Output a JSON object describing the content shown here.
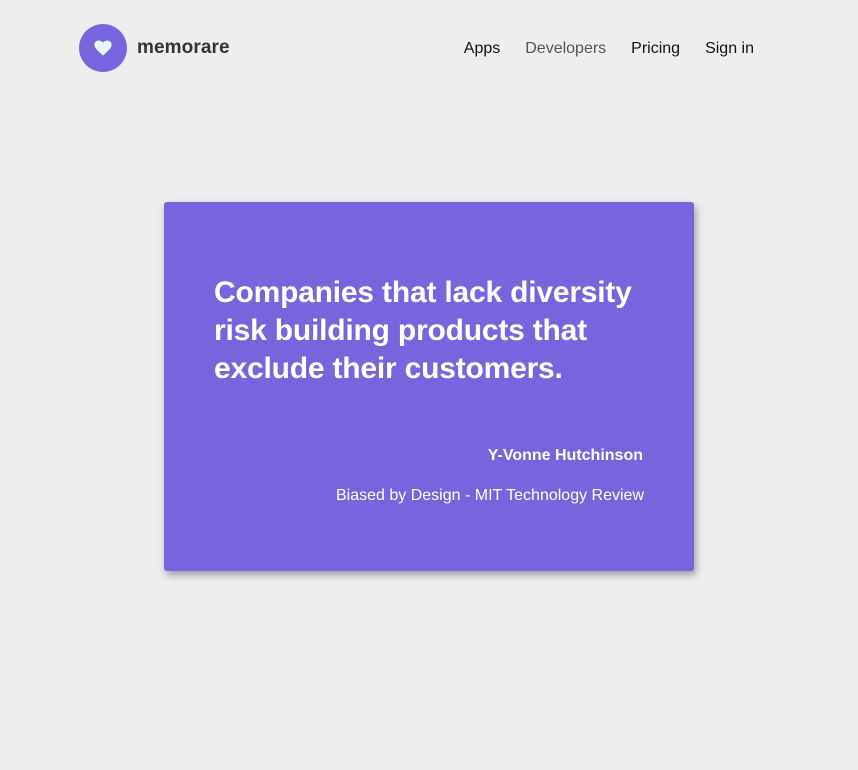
{
  "header": {
    "brand_name": "memorare",
    "logo_icon": "heart-icon",
    "nav": {
      "apps": "Apps",
      "developers": "Developers",
      "pricing": "Pricing",
      "sign_in": "Sign in"
    }
  },
  "quote_card": {
    "quote": "Companies that lack diversity risk building products that exclude their customers.",
    "author": "Y-Vonne Hutchinson",
    "source": "Biased by Design - MIT Technology Review"
  },
  "colors": {
    "accent": "#7665dc",
    "background": "#eeeeee",
    "logo_heart": "#e6f6f4"
  }
}
